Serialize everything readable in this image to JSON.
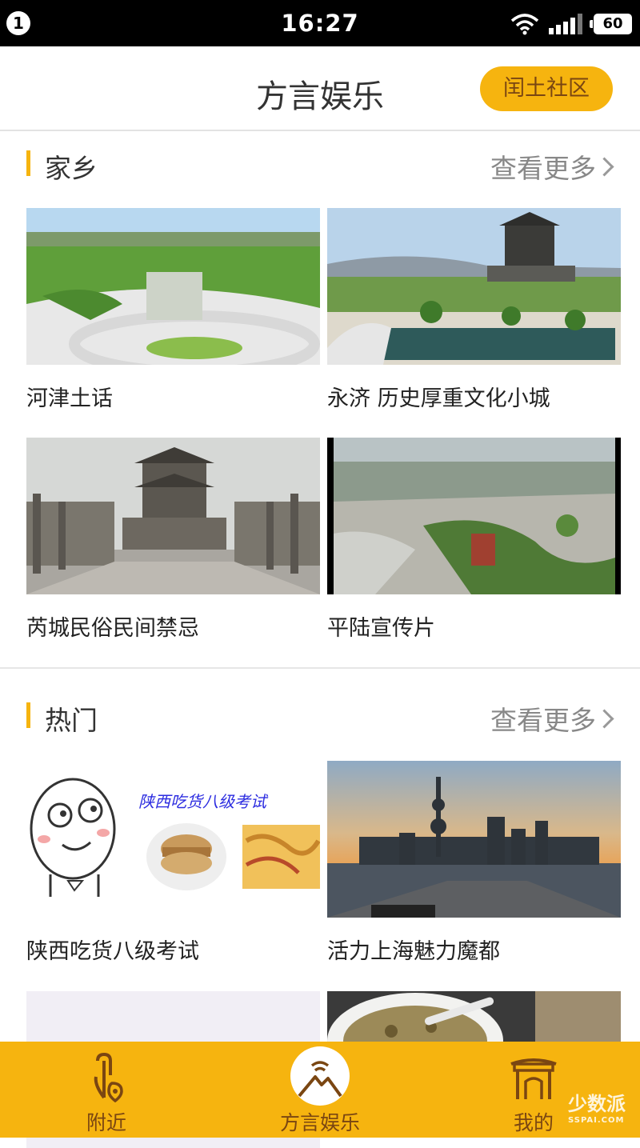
{
  "status_bar": {
    "notification_count": "1",
    "time": "16:27",
    "battery": "60"
  },
  "header": {
    "title": "方言娱乐",
    "community_button": "闰土社区"
  },
  "sections": [
    {
      "title": "家乡",
      "more_label": "查看更多",
      "items": [
        {
          "caption": "河津土话"
        },
        {
          "caption": "永济 历史厚重文化小城"
        },
        {
          "caption": "芮城民俗民间禁忌"
        },
        {
          "caption": "平陆宣传片"
        }
      ]
    },
    {
      "title": "热门",
      "more_label": "查看更多",
      "items": [
        {
          "caption": "陕西吃货八级考试",
          "image_text": "陕西吃货八级考试"
        },
        {
          "caption": "活力上海魅力魔都"
        }
      ]
    }
  ],
  "tabbar": {
    "tabs": [
      {
        "label": "附近",
        "icon": "location-pin-icon"
      },
      {
        "label": "方言娱乐",
        "icon": "mountain-signal-icon"
      },
      {
        "label": "我的",
        "icon": "gate-icon"
      }
    ]
  },
  "watermark": {
    "name": "少数派",
    "url": "SSPAI.COM"
  }
}
